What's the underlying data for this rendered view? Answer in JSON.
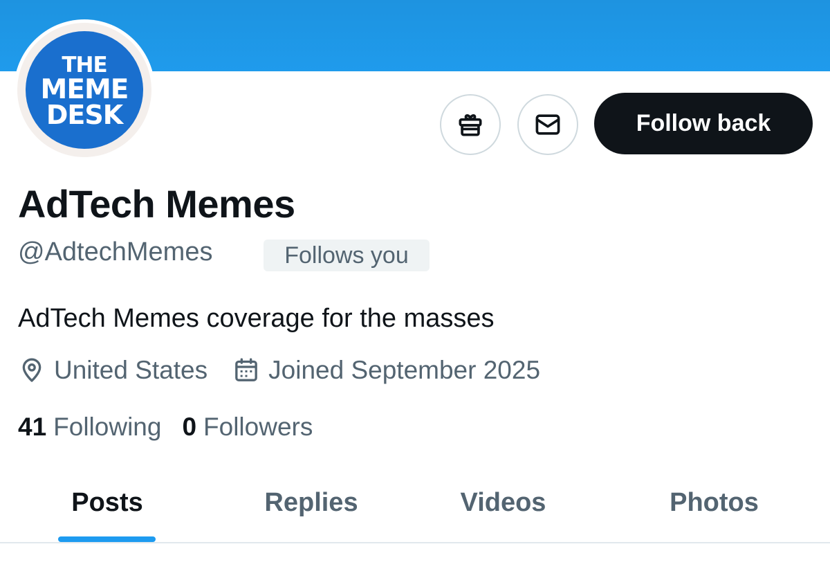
{
  "avatar": {
    "logo_line1": "THE",
    "logo_line2": "MEME",
    "logo_line3": "DESK",
    "logo_color": "#1a6fce"
  },
  "actions": {
    "gift_icon": "gift-icon",
    "message_icon": "mail-icon",
    "follow_label": "Follow back"
  },
  "profile": {
    "display_name": "AdTech Memes",
    "handle": "@AdtechMemes",
    "follows_you": "Follows you",
    "bio": "AdTech Memes coverage for the masses",
    "location": "United States",
    "joined": "Joined September 2025"
  },
  "stats": {
    "following_count": "41",
    "following_label": "Following",
    "followers_count": "0",
    "followers_label": "Followers"
  },
  "tabs": [
    {
      "label": "Posts",
      "active": true
    },
    {
      "label": "Replies",
      "active": false
    },
    {
      "label": "Videos",
      "active": false
    },
    {
      "label": "Photos",
      "active": false
    }
  ],
  "colors": {
    "banner": "#1d9bf0",
    "accent": "#1d9bf0",
    "primary_text": "#0f1419",
    "secondary_text": "#536471"
  }
}
